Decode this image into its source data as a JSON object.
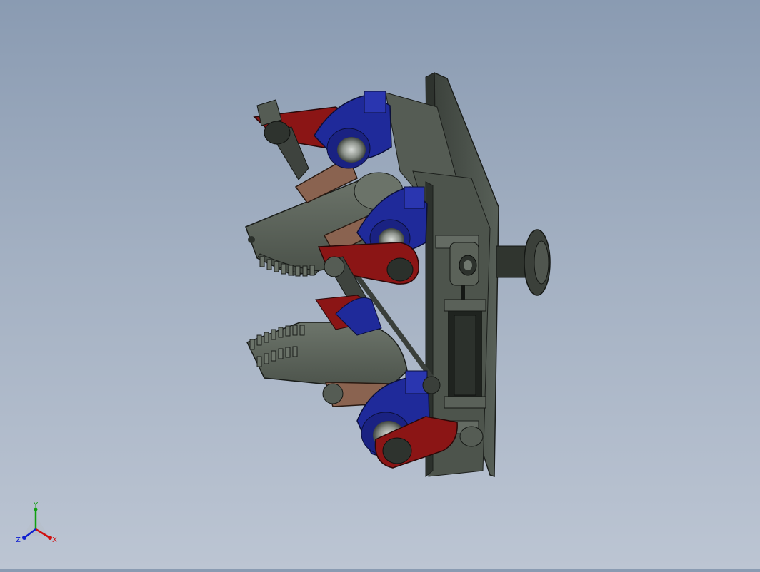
{
  "colors": {
    "background_top": "#8a9bb2",
    "background_bottom": "#bcc5d3",
    "plate": "#4a514a",
    "part_red": "#8b1515",
    "part_blue": "#1f2a9a",
    "part_copper": "#8a6350",
    "part_gray": "#5d645c",
    "axis_x": "#d01010",
    "axis_y": "#10a010",
    "axis_z": "#1020d0"
  },
  "triad": {
    "x_label": "X",
    "y_label": "Y",
    "z_label": "Z"
  }
}
